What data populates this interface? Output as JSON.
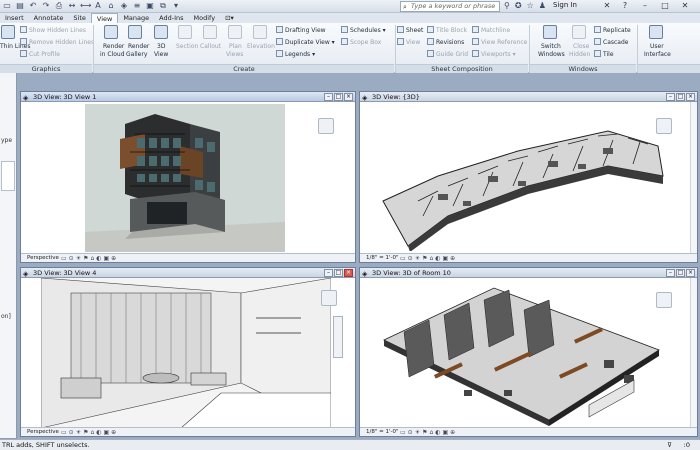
{
  "titlebar": {
    "search_placeholder": "Type a keyword or phrase",
    "sign_in": "Sign In"
  },
  "tabs": [
    "Insert",
    "Annotate",
    "Site",
    "View",
    "Manage",
    "Add-Ins",
    "Modify"
  ],
  "active_tab": "View",
  "ribbon": {
    "graphics": {
      "label": "Graphics",
      "thin_lines": "Thin Lines",
      "show_hidden_lines": "Show Hidden Lines",
      "remove_hidden_lines": "Remove Hidden Lines",
      "cut_profile": "Cut Profile"
    },
    "create": {
      "label": "Create",
      "render_cloud_1": "Render",
      "render_cloud_2": "in Cloud",
      "render_gallery_1": "Render",
      "render_gallery_2": "Gallery",
      "view_3d_1": "3D",
      "view_3d_2": "View",
      "section": "Section",
      "callout": "Callout",
      "plan_1": "Plan",
      "plan_2": "Views",
      "elevation": "Elevation",
      "drafting_view": "Drafting View",
      "duplicate_view": "Duplicate View",
      "legends": "Legends",
      "schedules": "Schedules",
      "scope_box": "Scope Box"
    },
    "sheet_composition": {
      "label": "Sheet Composition",
      "sheet": "Sheet",
      "title_block": "Title Block",
      "matchline": "Matchline",
      "view": "View",
      "revisions": "Revisions",
      "view_reference": "View Reference",
      "guide_grid": "Guide Grid",
      "viewports": "Viewports"
    },
    "windows": {
      "label": "Windows",
      "switch_1": "Switch",
      "switch_2": "Windows",
      "close_1": "Close",
      "close_2": "Hidden",
      "replicate": "Replicate",
      "cascade": "Cascade",
      "tile": "Tile",
      "user_interface_1": "User",
      "user_interface_2": "Interface"
    }
  },
  "leftstrip": {
    "t1": "ype",
    "t2": "on]"
  },
  "views": [
    {
      "title": "3D View: 3D View 1",
      "status": "Perspective"
    },
    {
      "title": "3D View: {3D}",
      "status": "1/8\" = 1'-0\""
    },
    {
      "title": "3D View: 3D View 4",
      "status": "Perspective"
    },
    {
      "title": "3D View: 3D of Room 10",
      "status": "1/8\" = 1'-0\""
    }
  ],
  "statusbar": {
    "text": "TRL adds, SHIFT unselects.",
    "filter_count": ":0"
  },
  "colors": {
    "ribbon_bg": "#e4eaf2",
    "workspace_bg": "#9aabc2",
    "close_btn": "#d95b4f"
  }
}
